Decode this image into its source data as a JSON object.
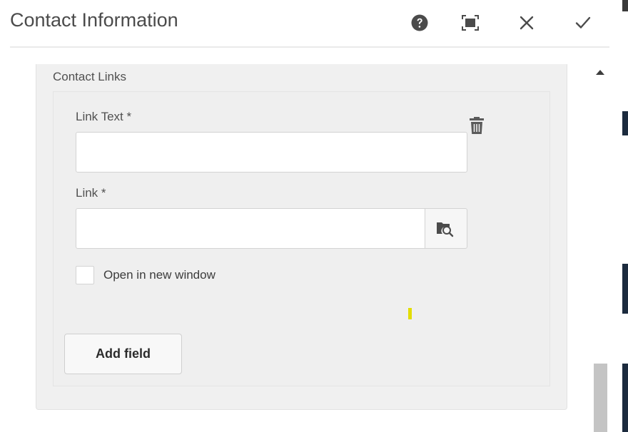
{
  "dialog": {
    "title": "Contact Information",
    "header_buttons": [
      {
        "name": "help-button",
        "icon": "help-icon"
      },
      {
        "name": "fullscreen-button",
        "icon": "fullscreen-icon"
      },
      {
        "name": "cancel-button",
        "icon": "close-icon"
      },
      {
        "name": "done-button",
        "icon": "checkmark-icon"
      }
    ]
  },
  "section": {
    "label": "Contact Links",
    "item": {
      "link_text_label": "Link Text *",
      "link_text_value": "",
      "link_label": "Link *",
      "link_value": "",
      "open_new_window_label": "Open in new window",
      "open_new_window_checked": false,
      "delete_icon": "trash-icon",
      "browse_icon": "folder-search-icon"
    },
    "add_field_label": "Add field"
  },
  "colors": {
    "panel_bg": "#f0f0f0",
    "text": "#4b4b4b",
    "border": "#d3d3d3",
    "accent_mark": "#e2dd00"
  }
}
